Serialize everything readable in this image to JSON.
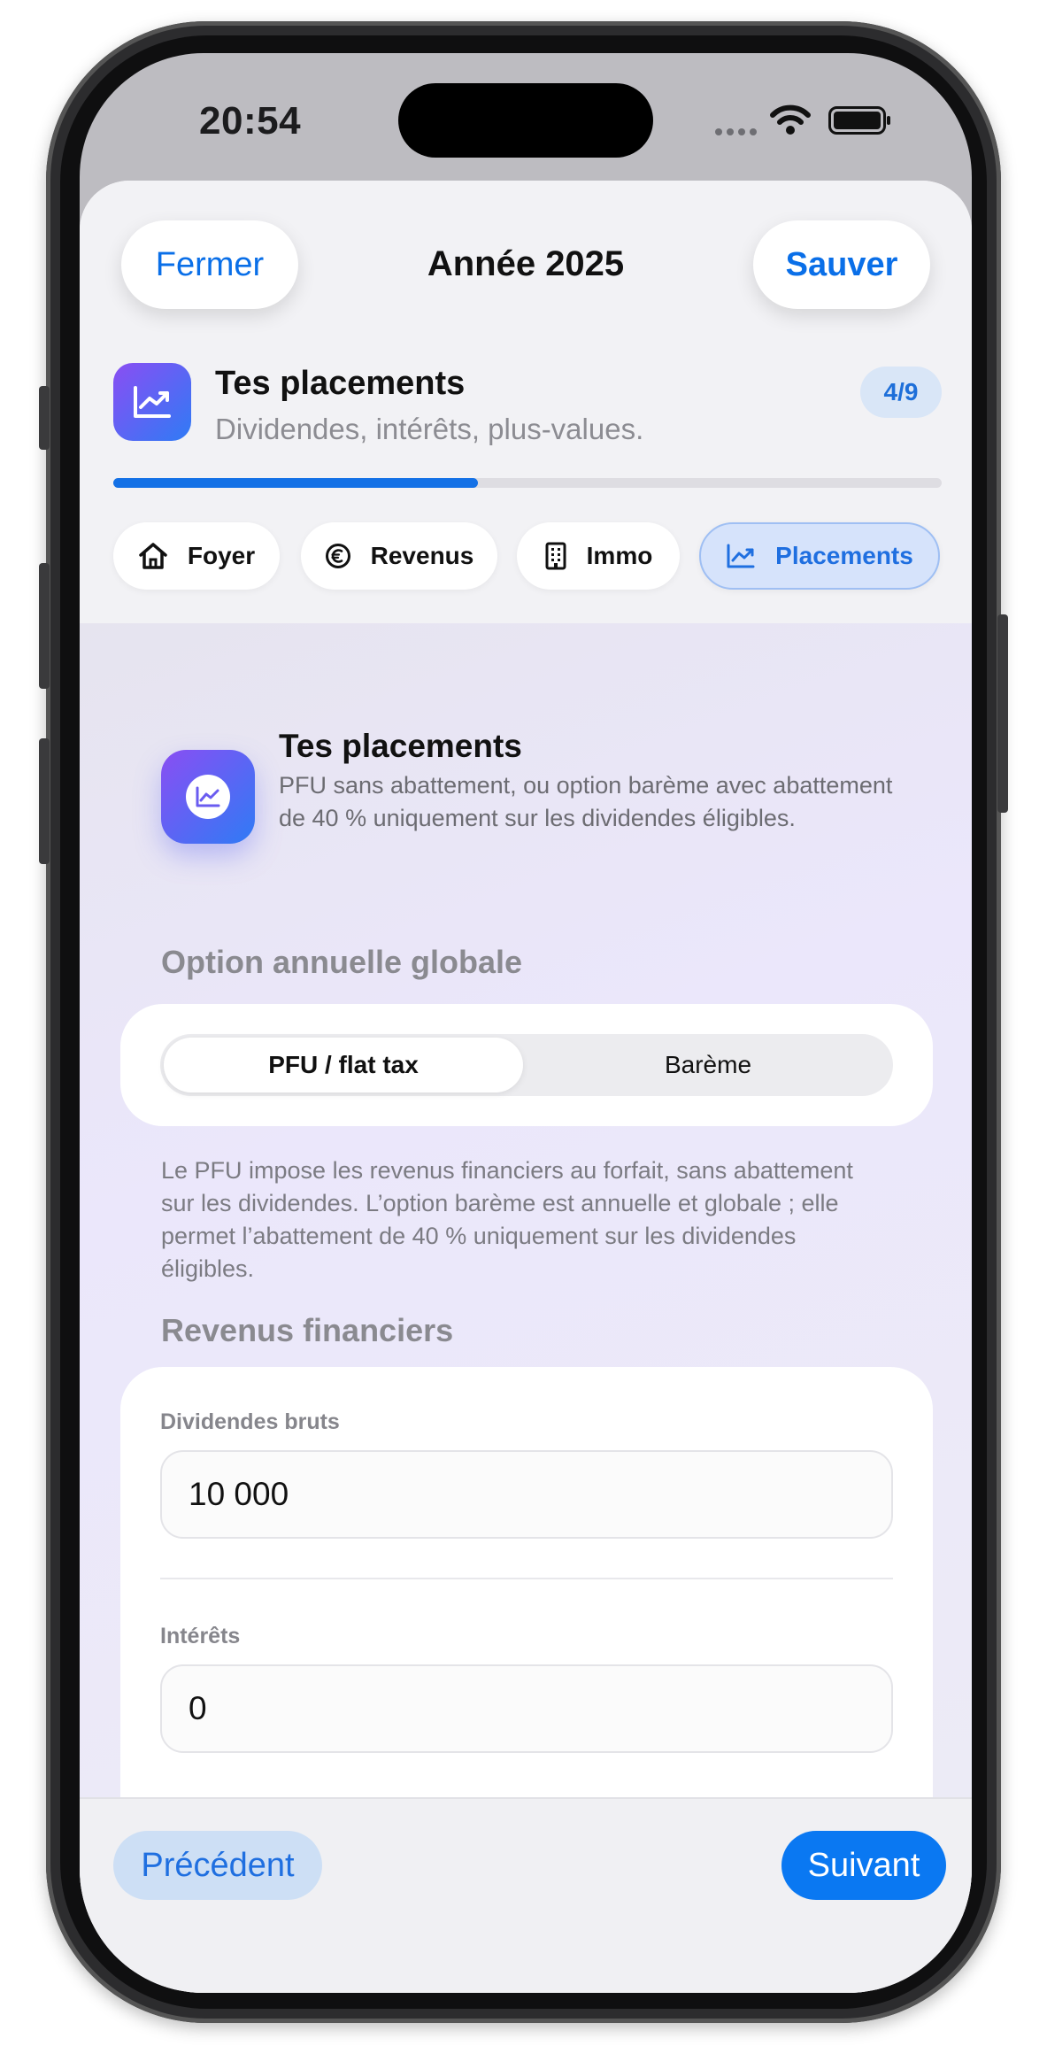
{
  "status_bar": {
    "time": "20:54"
  },
  "header": {
    "close_label": "Fermer",
    "title": "Année 2025",
    "save_label": "Sauver"
  },
  "step": {
    "title": "Tes placements",
    "subtitle": "Dividendes, intérêts, plus-values.",
    "badge": "4/9",
    "progress": 0.44
  },
  "chips": [
    {
      "label": "Foyer",
      "icon": "house-icon"
    },
    {
      "label": "Revenus",
      "icon": "euro-icon"
    },
    {
      "label": "Immo",
      "icon": "building-icon"
    },
    {
      "label": "Placements",
      "icon": "chart-icon"
    }
  ],
  "intro": {
    "title": "Tes placements",
    "description": "PFU sans abattement, ou option barème avec abattement de 40 % uniquement sur les dividendes éligibles."
  },
  "option_section": {
    "label": "Option annuelle globale",
    "options": [
      "PFU / flat tax",
      "Barème"
    ],
    "selected": "PFU / flat tax",
    "note": "Le PFU impose les revenus financiers au forfait, sans abattement sur les dividendes. L’option barème est annuelle et globale ; elle permet l’abattement de 40 % uniquement sur les dividendes éligibles."
  },
  "income_section": {
    "label": "Revenus financiers",
    "fields": [
      {
        "label": "Dividendes bruts",
        "value": "10 000"
      },
      {
        "label": "Intérêts",
        "value": "0"
      }
    ]
  },
  "footer": {
    "prev_label": "Précédent",
    "next_label": "Suivant"
  },
  "colors": {
    "accent": "#0a78f2",
    "gradient_start": "#8a4ef3",
    "gradient_end": "#2f7bf5"
  }
}
